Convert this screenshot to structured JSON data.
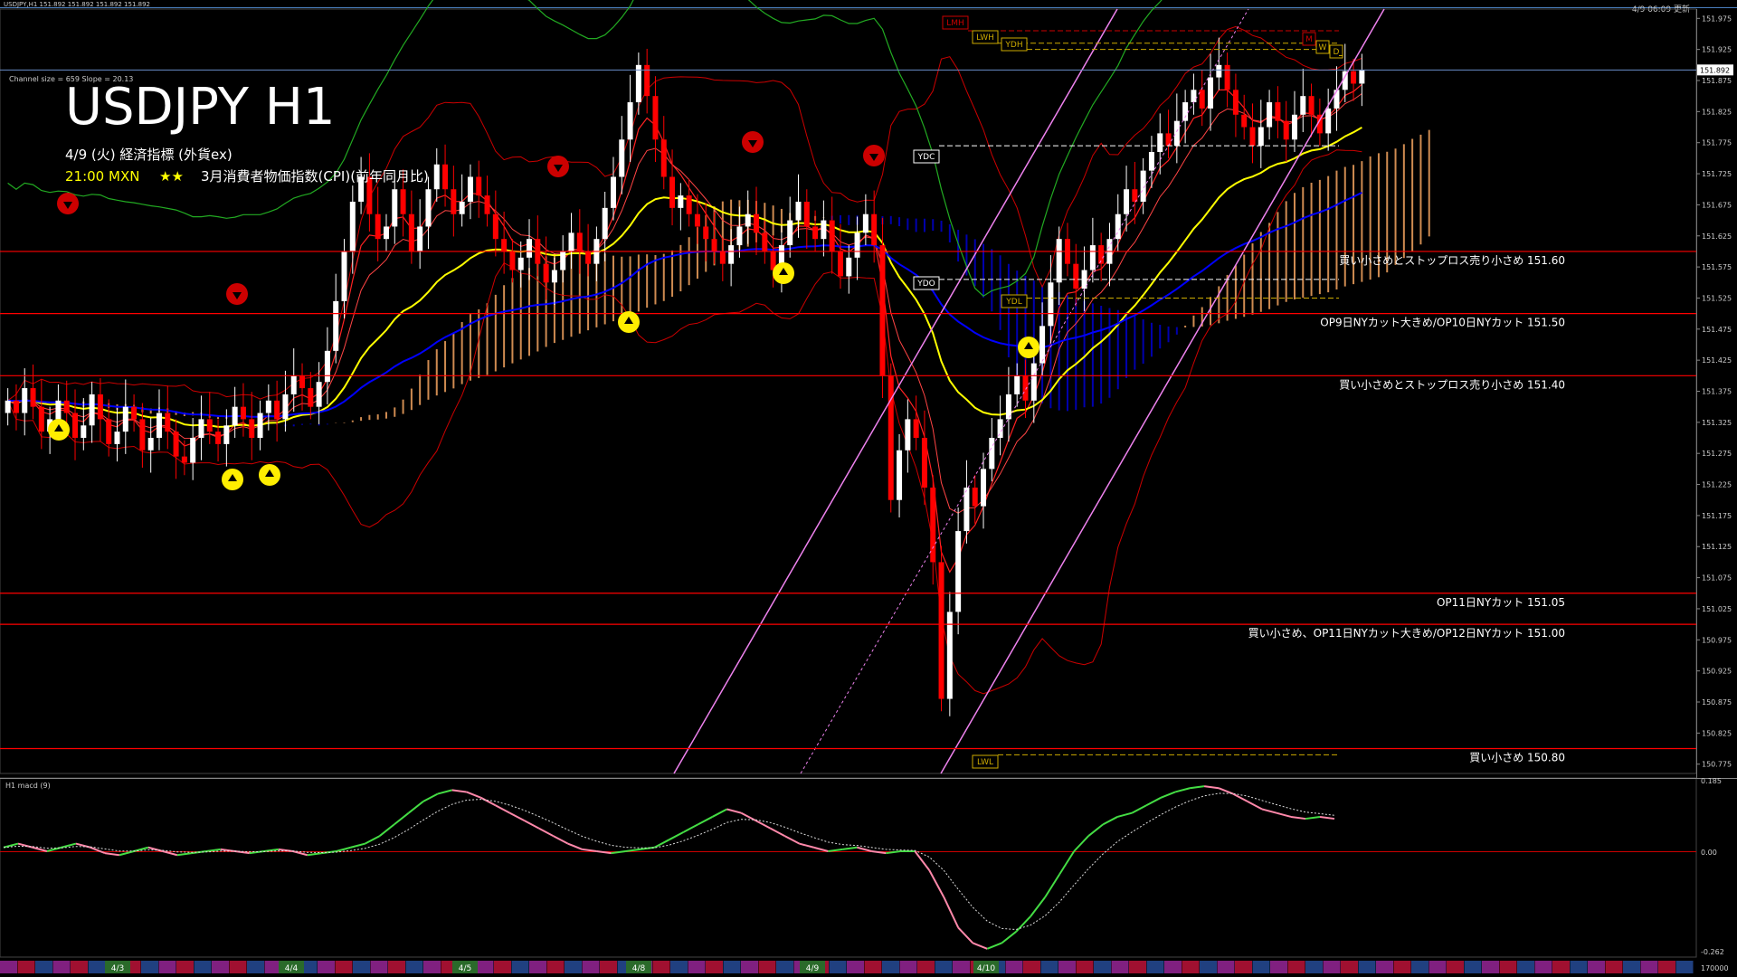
{
  "window": {
    "header_left": "USDJPY,H1  151.892 151.892 151.892 151.892",
    "header_right": "4/9 06:09 更新",
    "channel_info": "Channel size = 659  Slope = 20.13"
  },
  "panel": {
    "title": "USDJPY H1",
    "event_date": "4/9 (火) 経済指標 (外貨ex)",
    "event_time": "21:00 MXN",
    "event_stars": "★★",
    "event_name": "3月消費者物価指数(CPI)(前年同月比)"
  },
  "levels": [
    {
      "price": 151.6,
      "text": "買い小さめとストップロス売り小さめ 151.60"
    },
    {
      "price": 151.5,
      "text": "OP9日NYカット大きめ/OP10日NYカット 151.50"
    },
    {
      "price": 151.4,
      "text": "買い小さめとストップロス売り小さめ 151.40"
    },
    {
      "price": 151.05,
      "text": "OP11日NYカット 151.05"
    },
    {
      "price": 151.0,
      "text": "買い小さめ、OP11日NYカット大きめ/OP12日NYカット 151.00"
    },
    {
      "price": 150.8,
      "text": "買い小さめ 150.80"
    }
  ],
  "markers": {
    "boxes": [
      "LMH",
      "LWH",
      "YDH",
      "YDC",
      "YDO",
      "YDL",
      "LWL",
      "M",
      "W",
      "D"
    ],
    "current_price": "151.892"
  },
  "subpanel": {
    "label": "H1  macd (9)",
    "axis_max": "0.185",
    "axis_zero": "0.00",
    "axis_min": "-0.262",
    "bottom_right": "170000"
  },
  "dates": [
    "4/3",
    "4/4",
    "4/5",
    "4/8",
    "4/9",
    "4/10"
  ],
  "colors": {
    "up_candle": "#ffffff",
    "down_candle": "#ff0000",
    "level_line": "#ff0000",
    "ema_yellow": "#ffff00",
    "ema_blue": "#0000ff",
    "channel": "#ee82ee",
    "cloud_up": "#f4a460",
    "cloud_down": "#0000cd",
    "macd_up": "#44dd44",
    "macd_down": "#ff88aa"
  },
  "chart_data": {
    "type": "candlestick",
    "symbol": "USDJPY",
    "timeframe": "H1",
    "ylim": [
      150.76,
      151.99
    ],
    "y_ticks": [
      151.975,
      151.925,
      151.875,
      151.825,
      151.775,
      151.725,
      151.675,
      151.625,
      151.575,
      151.525,
      151.475,
      151.425,
      151.375,
      151.325,
      151.275,
      151.225,
      151.175,
      151.125,
      151.075,
      151.025,
      150.975,
      150.925,
      150.875,
      150.825,
      150.775
    ],
    "y_tick_labels": [
      "151.975",
      "151.925",
      "151.875",
      "151.825",
      "151.775",
      "151.725",
      "151.675",
      "151.625",
      "151.575",
      "151.525",
      "151.475",
      "151.425",
      "151.375",
      "151.325",
      "151.275",
      "151.225",
      "151.175",
      "151.125",
      "151.075",
      "151.025",
      "150.975",
      "150.925",
      "150.875",
      "150.825",
      "150.775"
    ],
    "close_series": [
      151.36,
      151.34,
      151.38,
      151.35,
      151.31,
      151.33,
      151.36,
      151.34,
      151.3,
      151.32,
      151.37,
      151.33,
      151.29,
      151.31,
      151.35,
      151.33,
      151.28,
      151.3,
      151.34,
      151.31,
      151.27,
      151.26,
      151.3,
      151.33,
      151.31,
      151.29,
      151.32,
      151.35,
      151.33,
      151.3,
      151.34,
      151.36,
      151.33,
      151.37,
      151.4,
      151.38,
      151.35,
      151.39,
      151.44,
      151.52,
      151.6,
      151.68,
      151.72,
      151.66,
      151.62,
      151.64,
      151.7,
      151.66,
      151.6,
      151.64,
      151.7,
      151.74,
      151.7,
      151.66,
      151.68,
      151.72,
      151.69,
      151.66,
      151.62,
      151.6,
      151.57,
      151.59,
      151.62,
      151.58,
      151.55,
      151.57,
      151.6,
      151.63,
      151.6,
      151.58,
      151.62,
      151.67,
      151.72,
      151.78,
      151.84,
      151.9,
      151.85,
      151.78,
      151.72,
      151.67,
      151.69,
      151.66,
      151.64,
      151.62,
      151.6,
      151.58,
      151.61,
      151.64,
      151.66,
      151.63,
      151.6,
      151.57,
      151.61,
      151.65,
      151.68,
      151.64,
      151.62,
      151.65,
      151.6,
      151.56,
      151.59,
      151.63,
      151.66,
      151.61,
      151.4,
      151.2,
      151.28,
      151.33,
      151.3,
      151.22,
      151.1,
      150.88,
      151.02,
      151.15,
      151.22,
      151.19,
      151.25,
      151.3,
      151.33,
      151.37,
      151.4,
      151.36,
      151.42,
      151.48,
      151.55,
      151.62,
      151.58,
      151.54,
      151.57,
      151.61,
      151.58,
      151.62,
      151.66,
      151.7,
      151.68,
      151.73,
      151.76,
      151.79,
      151.77,
      151.81,
      151.84,
      151.86,
      151.83,
      151.88,
      151.9,
      151.86,
      151.82,
      151.8,
      151.77,
      151.8,
      151.84,
      151.81,
      151.78,
      151.82,
      151.85,
      151.82,
      151.79,
      151.83,
      151.86,
      151.89,
      151.87,
      151.892
    ],
    "macd_series": [
      0.01,
      0.02,
      0.01,
      0.0,
      0.01,
      0.02,
      0.01,
      -0.005,
      -0.01,
      0.0,
      0.01,
      0.0,
      -0.01,
      -0.005,
      0.0,
      0.005,
      0.0,
      -0.005,
      0.0,
      0.005,
      0.0,
      -0.01,
      -0.005,
      0.0,
      0.01,
      0.02,
      0.04,
      0.07,
      0.1,
      0.13,
      0.15,
      0.16,
      0.155,
      0.14,
      0.12,
      0.1,
      0.08,
      0.06,
      0.04,
      0.02,
      0.005,
      0.0,
      -0.005,
      0.0,
      0.005,
      0.01,
      0.03,
      0.05,
      0.07,
      0.09,
      0.11,
      0.1,
      0.08,
      0.06,
      0.04,
      0.02,
      0.01,
      0.0,
      0.005,
      0.01,
      0.0,
      -0.005,
      0.0,
      0.0,
      -0.05,
      -0.12,
      -0.2,
      -0.24,
      -0.255,
      -0.24,
      -0.21,
      -0.17,
      -0.12,
      -0.06,
      0.0,
      0.04,
      0.07,
      0.09,
      0.1,
      0.12,
      0.14,
      0.155,
      0.165,
      0.17,
      0.165,
      0.15,
      0.13,
      0.11,
      0.1,
      0.09,
      0.085,
      0.09,
      0.085
    ],
    "ylabel": "",
    "xlabel": ""
  }
}
